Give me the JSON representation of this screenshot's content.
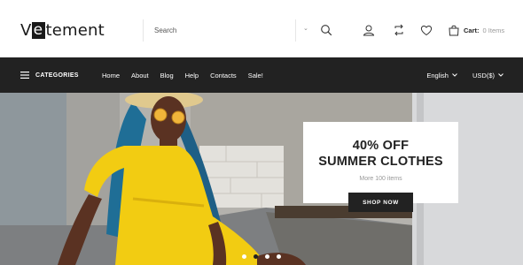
{
  "brand": {
    "logo_first": "e",
    "logo_prefix": "V",
    "logo_rest": "tement"
  },
  "search": {
    "placeholder": "Search"
  },
  "header": {
    "cart_label": "Cart:",
    "cart_count": "0 Items",
    "icons": [
      "search-icon",
      "user-icon",
      "compare-icon",
      "heart-icon",
      "cart-icon"
    ]
  },
  "nav": {
    "categories_label": "CATEGORIES",
    "links": [
      "Home",
      "About",
      "Blog",
      "Help",
      "Contacts",
      "Sale!"
    ],
    "language": "English",
    "currency": "USD($)"
  },
  "hero": {
    "title_line1": "40% OFF",
    "title_line2": "SUMMER CLOTHES",
    "subtitle": "More 100 items",
    "button_label": "SHOP NOW",
    "slides_count": 4,
    "active_slide": 1
  },
  "colors": {
    "dark": "#222222",
    "white": "#ffffff",
    "accent_yellow": "#f2cc12"
  }
}
